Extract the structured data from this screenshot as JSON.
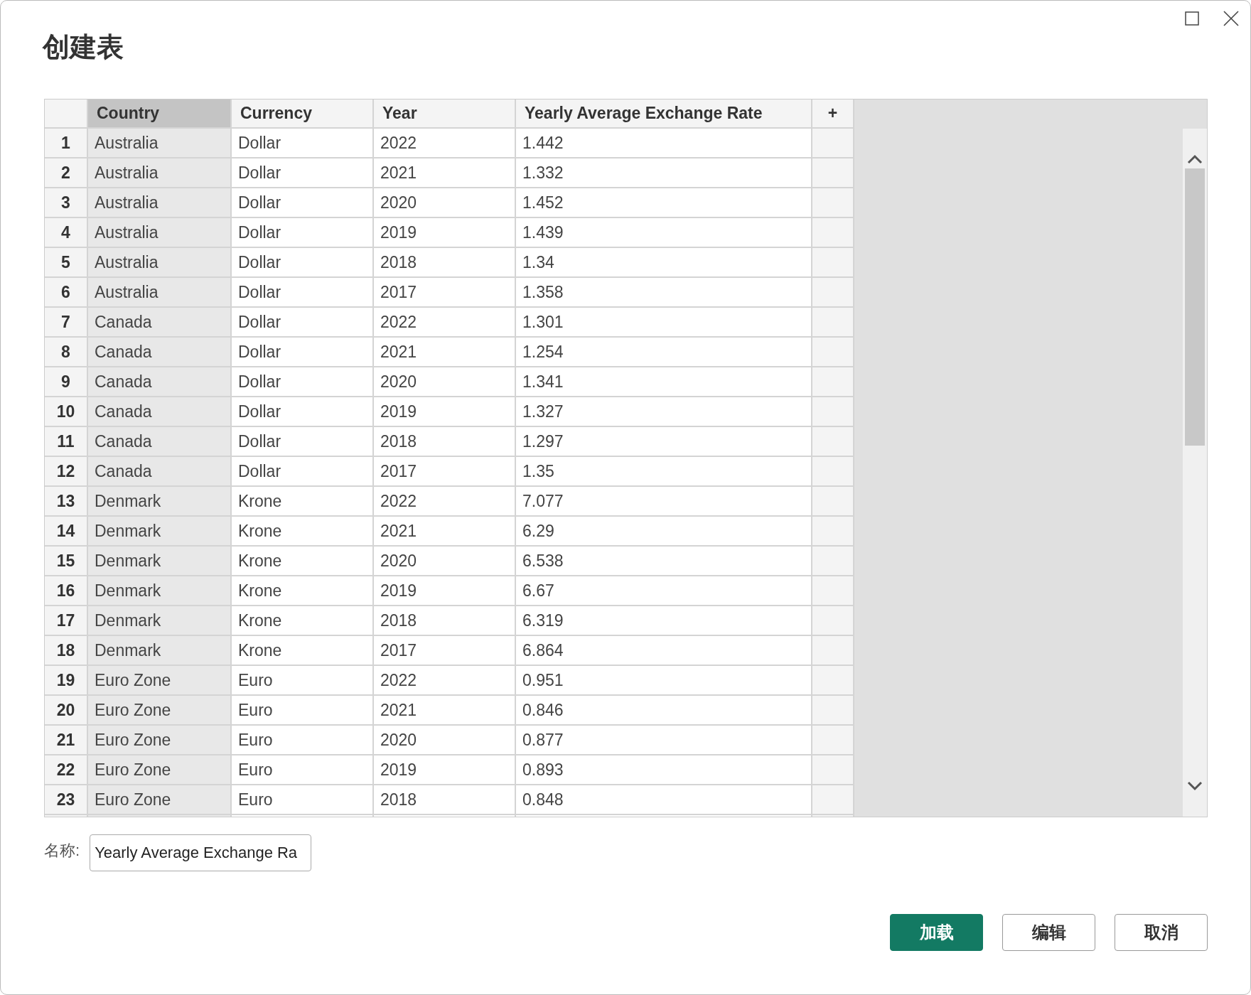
{
  "dialog": {
    "title": "创建表"
  },
  "table": {
    "columns": [
      {
        "label": "Country",
        "selected": true
      },
      {
        "label": "Currency",
        "selected": false
      },
      {
        "label": "Year",
        "selected": false
      },
      {
        "label": "Yearly Average Exchange Rate",
        "selected": false
      }
    ],
    "add_column": "+",
    "rows": [
      {
        "number": "1",
        "cells": [
          "Australia",
          "Dollar",
          "2022",
          "1.442"
        ]
      },
      {
        "number": "2",
        "cells": [
          "Australia",
          "Dollar",
          "2021",
          "1.332"
        ]
      },
      {
        "number": "3",
        "cells": [
          "Australia",
          "Dollar",
          "2020",
          "1.452"
        ]
      },
      {
        "number": "4",
        "cells": [
          "Australia",
          "Dollar",
          "2019",
          "1.439"
        ]
      },
      {
        "number": "5",
        "cells": [
          "Australia",
          "Dollar",
          "2018",
          "1.34"
        ]
      },
      {
        "number": "6",
        "cells": [
          "Australia",
          "Dollar",
          "2017",
          "1.358"
        ]
      },
      {
        "number": "7",
        "cells": [
          "Canada",
          "Dollar",
          "2022",
          "1.301"
        ]
      },
      {
        "number": "8",
        "cells": [
          "Canada",
          "Dollar",
          "2021",
          "1.254"
        ]
      },
      {
        "number": "9",
        "cells": [
          "Canada",
          "Dollar",
          "2020",
          "1.341"
        ]
      },
      {
        "number": "10",
        "cells": [
          "Canada",
          "Dollar",
          "2019",
          "1.327"
        ]
      },
      {
        "number": "11",
        "cells": [
          "Canada",
          "Dollar",
          "2018",
          "1.297"
        ]
      },
      {
        "number": "12",
        "cells": [
          "Canada",
          "Dollar",
          "2017",
          "1.35"
        ]
      },
      {
        "number": "13",
        "cells": [
          "Denmark",
          "Krone",
          "2022",
          "7.077"
        ]
      },
      {
        "number": "14",
        "cells": [
          "Denmark",
          "Krone",
          "2021",
          "6.29"
        ]
      },
      {
        "number": "15",
        "cells": [
          "Denmark",
          "Krone",
          "2020",
          "6.538"
        ]
      },
      {
        "number": "16",
        "cells": [
          "Denmark",
          "Krone",
          "2019",
          "6.67"
        ]
      },
      {
        "number": "17",
        "cells": [
          "Denmark",
          "Krone",
          "2018",
          "6.319"
        ]
      },
      {
        "number": "18",
        "cells": [
          "Denmark",
          "Krone",
          "2017",
          "6.864"
        ]
      },
      {
        "number": "19",
        "cells": [
          "Euro Zone",
          "Euro",
          "2022",
          "0.951"
        ]
      },
      {
        "number": "20",
        "cells": [
          "Euro Zone",
          "Euro",
          "2021",
          "0.846"
        ]
      },
      {
        "number": "21",
        "cells": [
          "Euro Zone",
          "Euro",
          "2020",
          "0.877"
        ]
      },
      {
        "number": "22",
        "cells": [
          "Euro Zone",
          "Euro",
          "2019",
          "0.893"
        ]
      },
      {
        "number": "23",
        "cells": [
          "Euro Zone",
          "Euro",
          "2018",
          "0.848"
        ]
      }
    ]
  },
  "name_field": {
    "label": "名称:",
    "value": "Yearly Average Exchange Ra"
  },
  "buttons": [
    {
      "label": "加载",
      "kind": "primary"
    },
    {
      "label": "编辑",
      "kind": "secondary"
    },
    {
      "label": "取消",
      "kind": "secondary"
    }
  ]
}
